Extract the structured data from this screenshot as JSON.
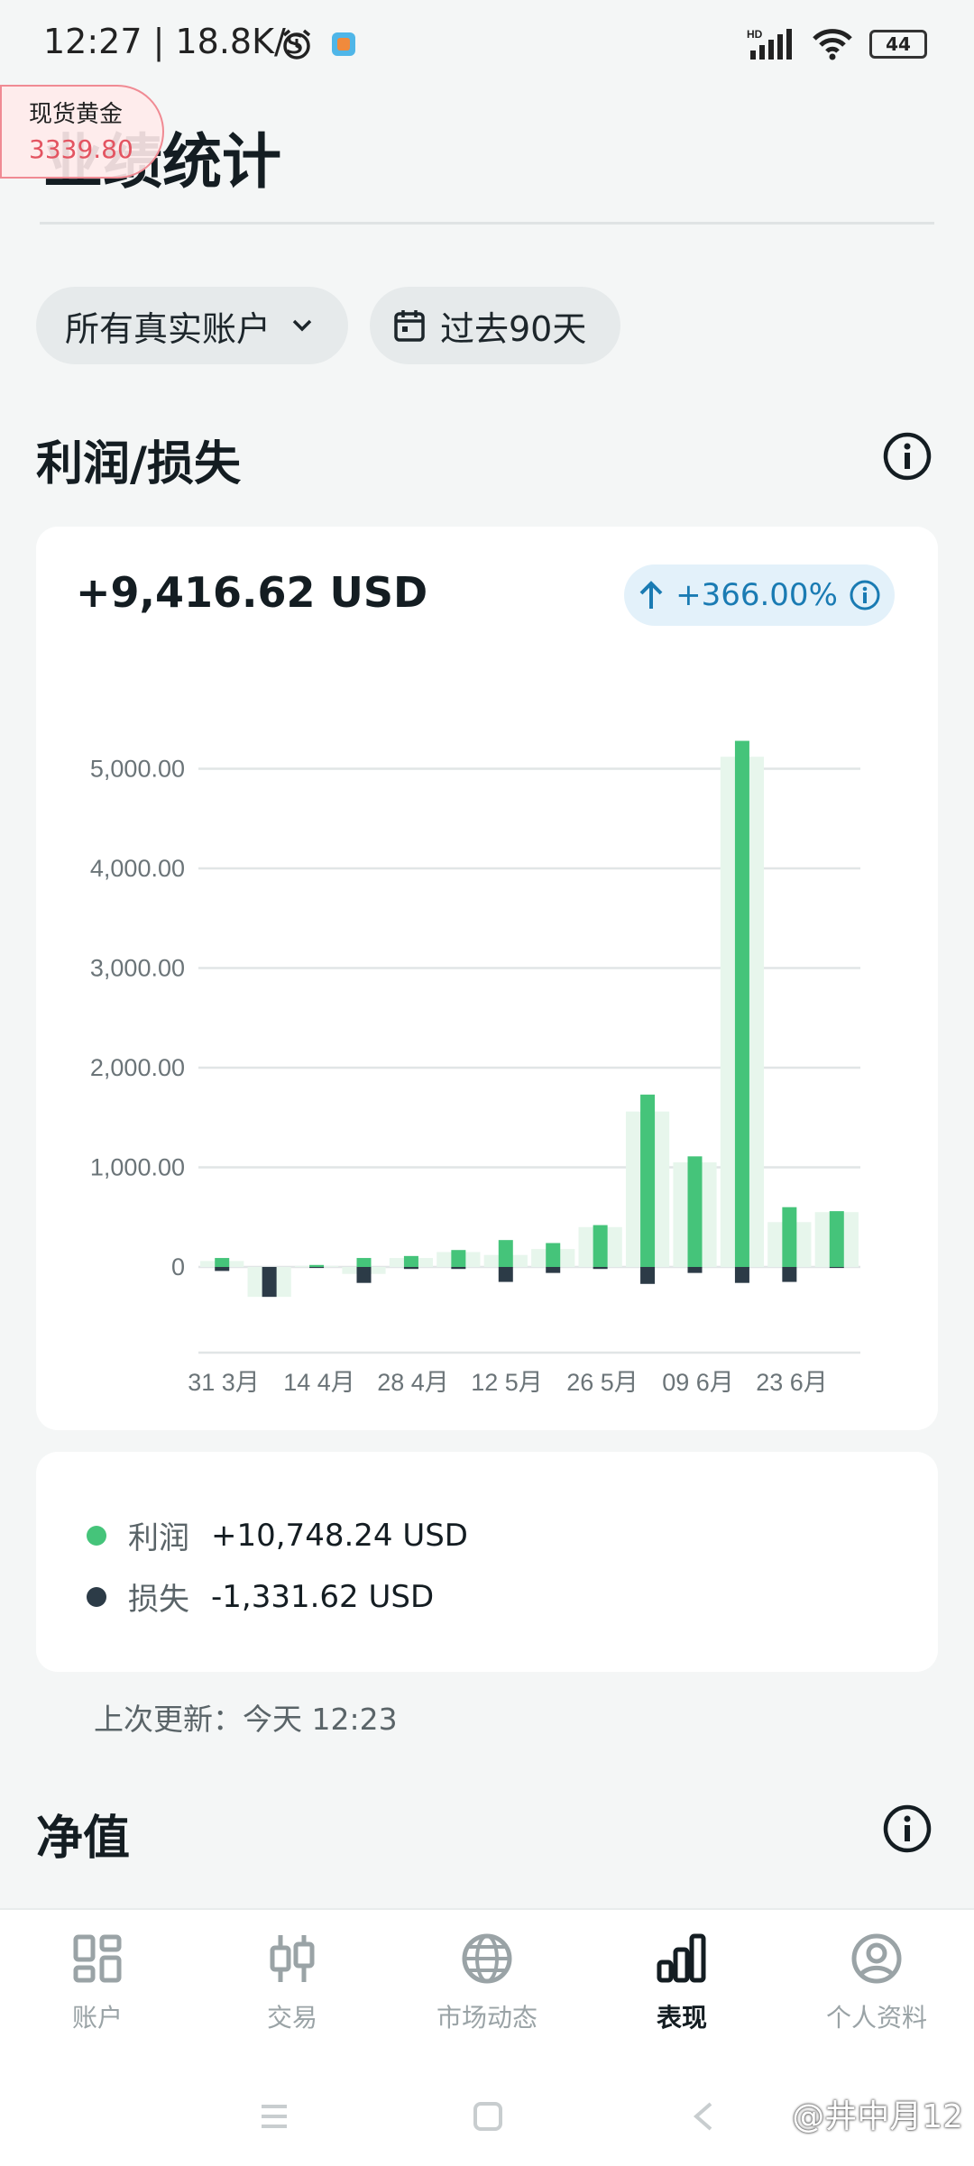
{
  "status_bar": {
    "time": "12:27 | 18.8K/s",
    "battery": "44"
  },
  "gold_widget": {
    "name": "现货黄金",
    "price": "3339.80"
  },
  "page": {
    "title": "业绩统计"
  },
  "filters": {
    "account": "所有真实账户",
    "period": "过去90天"
  },
  "profit_loss": {
    "title": "利润/损失",
    "total": "+9,416.62 USD",
    "change": "+366.00%",
    "legend": [
      {
        "label": "利润",
        "value": "+10,748.24 USD",
        "color": "#45c47a"
      },
      {
        "label": "损失",
        "value": "-1,331.62 USD",
        "color": "#2c3b47"
      }
    ],
    "updated": "上次更新：今天 12:23"
  },
  "chart_data": {
    "type": "bar",
    "ylim": [
      -800,
      5600
    ],
    "yticks": [
      "5,000.00",
      "4,000.00",
      "3,000.00",
      "2,000.00",
      "1,000.00",
      "0"
    ],
    "ytick_values": [
      5000,
      4000,
      3000,
      2000,
      1000,
      0
    ],
    "xticks": [
      "31 3月",
      "14 4月",
      "28 4月",
      "12 5月",
      "26 5月",
      "09 6月",
      "23 6月"
    ],
    "series": [
      {
        "name": "利润",
        "values": [
          90,
          0,
          20,
          90,
          110,
          170,
          270,
          240,
          420,
          1730,
          1110,
          5280,
          600,
          560
        ]
      },
      {
        "name": "损失",
        "values": [
          -40,
          -300,
          -10,
          -160,
          -20,
          -20,
          -150,
          -60,
          -20,
          -170,
          -60,
          -160,
          -150,
          -10
        ]
      },
      {
        "name": "",
        "values": [
          60,
          -300,
          10,
          -70,
          90,
          150,
          120,
          180,
          400,
          1560,
          1050,
          5120,
          450,
          550
        ]
      }
    ],
    "colors": {
      "profit": "#45c47a",
      "loss": "#2c3b47",
      "net": "#e7f6ec",
      "grid": "#e1e5e6"
    }
  },
  "net_value": {
    "title": "净值"
  },
  "nav": [
    {
      "label": "账户",
      "icon": "dashboard-icon"
    },
    {
      "label": "交易",
      "icon": "candlestick-icon"
    },
    {
      "label": "市场动态",
      "icon": "globe-icon"
    },
    {
      "label": "表现",
      "icon": "bar-chart-icon"
    },
    {
      "label": "个人资料",
      "icon": "profile-icon"
    }
  ],
  "watermark": "@井中月12"
}
